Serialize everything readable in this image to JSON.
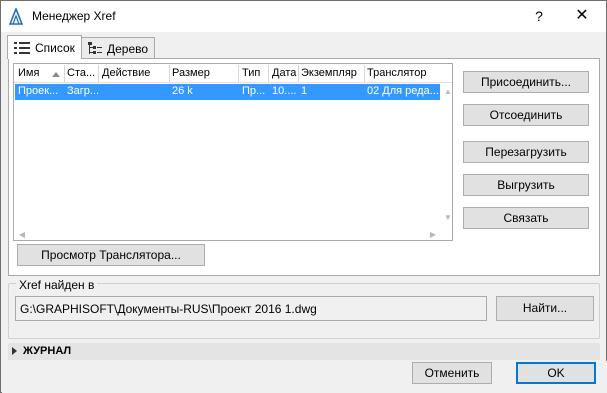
{
  "window": {
    "title": "Менеджер Xref",
    "help": "?",
    "close": "✕"
  },
  "tabs": [
    {
      "label": "Список",
      "icon": "list-icon",
      "active": true
    },
    {
      "label": "Дерево",
      "icon": "tree-icon",
      "active": false
    }
  ],
  "table": {
    "columns": [
      "Имя",
      "Ста...",
      "Действие",
      "Размер",
      "Тип",
      "Дата",
      "Экземпляр",
      "Транслятор"
    ],
    "sort_column": "Имя",
    "rows": [
      [
        "Проек...",
        "Загр...",
        "",
        "26 k",
        "Пр...",
        "10....",
        "1",
        "02 Для реда..."
      ]
    ],
    "selected_row": 0
  },
  "buttons": {
    "attach": "Присоединить...",
    "detach": "Отсоединить",
    "reload": "Перезагрузить",
    "unload": "Выгрузить",
    "bind": "Связать",
    "translator_preview": "Просмотр Транслятора...",
    "find": "Найти...",
    "cancel": "Отменить",
    "ok": "OK"
  },
  "found_in": {
    "legend": "Xref найден в",
    "path": "G:\\GRAPHISOFT\\Документы-RUS\\Проект 2016 1.dwg"
  },
  "journal": {
    "label": "ЖУРНАЛ"
  },
  "colors": {
    "selection": "#3399ff",
    "default_button_border": "#0078d7",
    "app_icon": "#1f6fb5"
  }
}
